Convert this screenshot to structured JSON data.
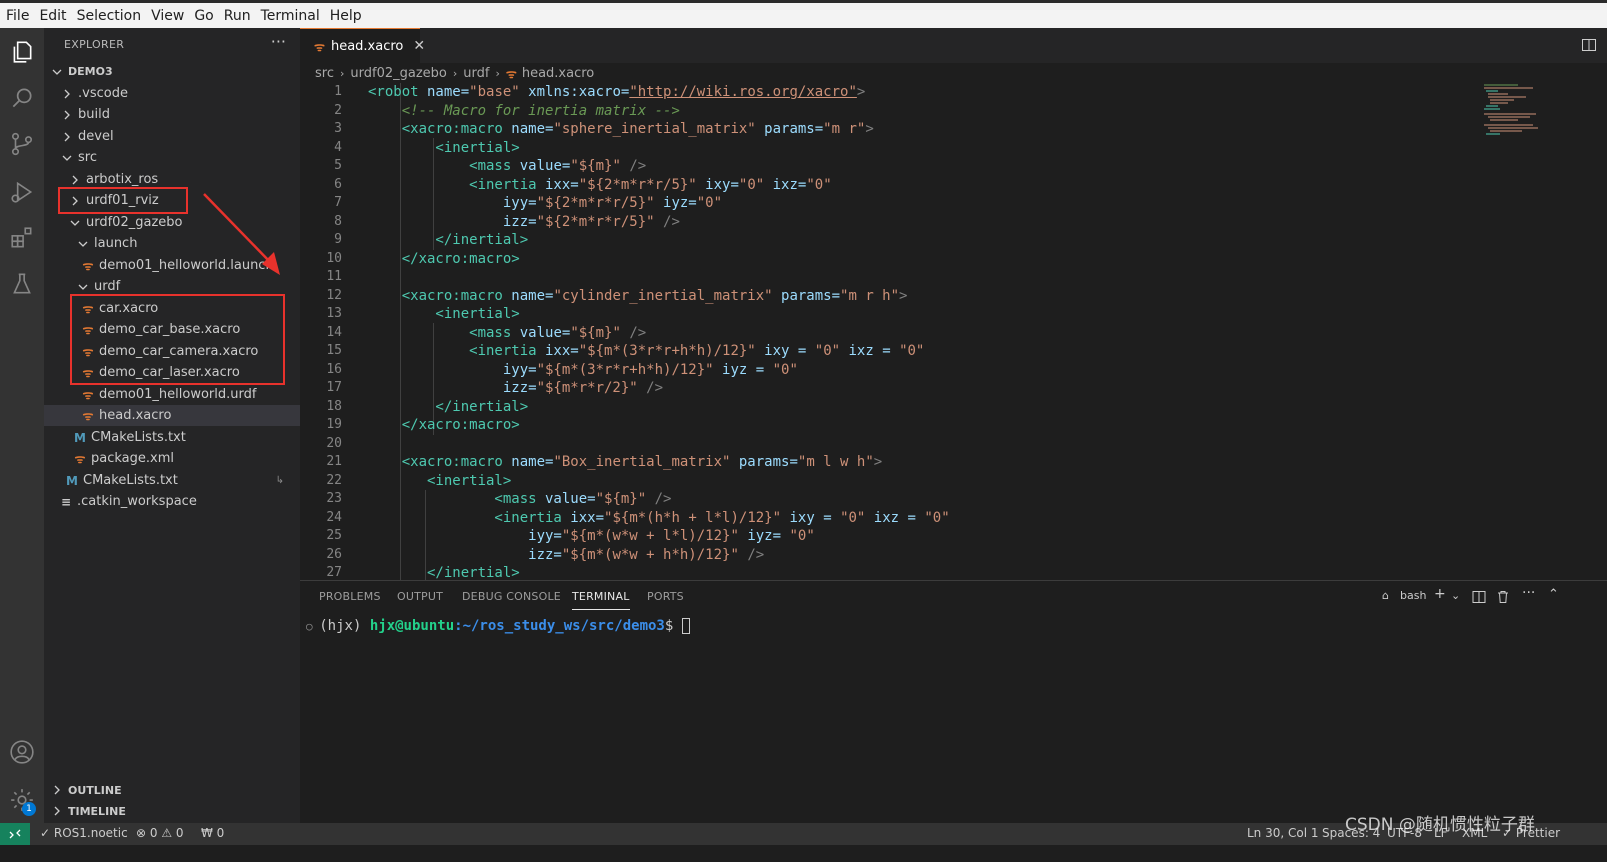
{
  "menu": [
    "File",
    "Edit",
    "Selection",
    "View",
    "Go",
    "Run",
    "Terminal",
    "Help"
  ],
  "activity_bar": {
    "icons": [
      "explorer-icon",
      "search-icon",
      "source-control-icon",
      "run-debug-icon",
      "extensions-icon",
      "testing-icon",
      "account-icon",
      "settings-gear-icon"
    ],
    "settings_badge": "1"
  },
  "sidebar": {
    "title": "EXPLORER",
    "more": "···",
    "root": "DEMO3",
    "tree": [
      {
        "label": ".vscode",
        "icon": "chevron-right-icon"
      },
      {
        "label": "build",
        "icon": "chevron-right-icon"
      },
      {
        "label": "devel",
        "icon": "chevron-right-icon"
      },
      {
        "label": "src",
        "icon": "chevron-down-icon"
      },
      {
        "label": "arbotix_ros",
        "icon": "chevron-right-icon"
      },
      {
        "label": "urdf01_rviz",
        "icon": "chevron-right-icon"
      },
      {
        "label": "urdf02_gazebo",
        "icon": "chevron-down-icon"
      },
      {
        "label": "launch",
        "icon": "chevron-down-icon"
      },
      {
        "label": "demo01_helloworld.launch",
        "icon": "rss-file-icon"
      },
      {
        "label": "urdf",
        "icon": "chevron-down-icon"
      },
      {
        "label": "car.xacro",
        "icon": "rss-file-icon"
      },
      {
        "label": "demo_car_base.xacro",
        "icon": "rss-file-icon"
      },
      {
        "label": "demo_car_camera.xacro",
        "icon": "rss-file-icon"
      },
      {
        "label": "demo_car_laser.xacro",
        "icon": "rss-file-icon"
      },
      {
        "label": "demo01_helloworld.urdf",
        "icon": "rss-file-icon"
      },
      {
        "label": "head.xacro",
        "icon": "rss-file-icon"
      },
      {
        "label": "CMakeLists.txt",
        "icon": "cmake-file-icon"
      },
      {
        "label": "package.xml",
        "icon": "rss-file-icon"
      },
      {
        "label": "CMakeLists.txt",
        "icon": "cmake-file-icon"
      },
      {
        "label": ".catkin_workspace",
        "icon": "text-file-icon"
      }
    ],
    "outline": "OUTLINE",
    "timeline": "TIMELINE"
  },
  "editor": {
    "tab_label": "head.xacro",
    "tab_close": "✕",
    "breadcrumb": [
      "src",
      "urdf02_gazebo",
      "urdf",
      "head.xacro"
    ],
    "line_numbers": [
      "1",
      "2",
      "3",
      "4",
      "5",
      "6",
      "7",
      "8",
      "9",
      "10",
      "11",
      "12",
      "13",
      "14",
      "15",
      "16",
      "17",
      "18",
      "19",
      "20",
      "21",
      "22",
      "23",
      "24",
      "25",
      "26",
      "27"
    ],
    "code": {
      "l1_tag": "<robot",
      "l1_attr1": " name=",
      "l1_val1": "\"base\"",
      "l1_attr2": " xmlns:xacro=",
      "l1_link": "\"http://wiki.ros.org/xacro\"",
      "l1_end": ">",
      "l2": "    <!-- Macro for inertia matrix -->",
      "l3_tag": "    <xacro:macro",
      "l3_attr1": " name=",
      "l3_val1": "\"sphere_inertial_matrix\"",
      "l3_attr2": " params=",
      "l3_val2": "\"m r\"",
      "l3_end": ">",
      "l4": "        <inertial>",
      "l5_tag": "            <mass",
      "l5_attr": " value=",
      "l5_val": "\"${m}\"",
      "l5_end": " />",
      "l6_tag": "            <inertia",
      "l6_a1": " ixx=",
      "l6_v1": "\"${2*m*r*r/5}\"",
      "l6_a2": " ixy=",
      "l6_v2": "\"0\"",
      "l6_a3": " ixz=",
      "l6_v3": "\"0\"",
      "l7_a1": "                iyy=",
      "l7_v1": "\"${2*m*r*r/5}\"",
      "l7_a2": " iyz=",
      "l7_v2": "\"0\"",
      "l8_a1": "                izz=",
      "l8_v1": "\"${2*m*r*r/5}\"",
      "l8_end": " />",
      "l9": "        </inertial>",
      "l10": "    </xacro:macro>",
      "l12_tag": "    <xacro:macro",
      "l12_attr1": " name=",
      "l12_val1": "\"cylinder_inertial_matrix\"",
      "l12_attr2": " params=",
      "l12_val2": "\"m r h\"",
      "l12_end": ">",
      "l13": "        <inertial>",
      "l14_tag": "            <mass",
      "l14_attr": " value=",
      "l14_val": "\"${m}\"",
      "l14_end": " />",
      "l15_tag": "            <inertia",
      "l15_a1": " ixx=",
      "l15_v1": "\"${m*(3*r*r+h*h)/12}\"",
      "l15_a2": " ixy = ",
      "l15_v2": "\"0\"",
      "l15_a3": " ixz = ",
      "l15_v3": "\"0\"",
      "l16_a1": "                iyy=",
      "l16_v1": "\"${m*(3*r*r+h*h)/12}\"",
      "l16_a2": " iyz = ",
      "l16_v2": "\"0\"",
      "l17_a1": "                izz=",
      "l17_v1": "\"${m*r*r/2}\"",
      "l17_end": " />",
      "l18": "        </inertial>",
      "l19": "    </xacro:macro>",
      "l21_tag": "    <xacro:macro",
      "l21_attr1": " name=",
      "l21_val1": "\"Box_inertial_matrix\"",
      "l21_attr2": " params=",
      "l21_val2": "\"m l w h\"",
      "l21_end": ">",
      "l22": "       <inertial>",
      "l23_tag": "               <mass",
      "l23_attr": " value=",
      "l23_val": "\"${m}\"",
      "l23_end": " />",
      "l24_tag": "               <inertia",
      "l24_a1": " ixx=",
      "l24_v1": "\"${m*(h*h + l*l)/12}\"",
      "l24_a2": " ixy = ",
      "l24_v2": "\"0\"",
      "l24_a3": " ixz = ",
      "l24_v3": "\"0\"",
      "l25_a1": "                   iyy=",
      "l25_v1": "\"${m*(w*w + l*l)/12}\"",
      "l25_a2": " iyz= ",
      "l25_v2": "\"0\"",
      "l26_a1": "                   izz=",
      "l26_v1": "\"${m*(w*w + h*h)/12}\"",
      "l26_end": " />",
      "l27": "       </inertial>"
    }
  },
  "panel": {
    "tabs": [
      "PROBLEMS",
      "OUTPUT",
      "DEBUG CONSOLE",
      "TERMINAL",
      "PORTS"
    ],
    "active_tab": "TERMINAL",
    "shell": "bash",
    "terminal": {
      "env": "(hjx)",
      "user_host": "hjx@ubuntu",
      "path": ":~/ros_study_ws/src/demo3",
      "prompt": "$ "
    }
  },
  "statusbar": {
    "remote_icon": "remote-icon",
    "ros": "✓ ROS1.noetic",
    "problems": "⊗ 0 ⚠ 0",
    "ports": "₩ 0",
    "position": "Ln 30, Col 1",
    "spaces": "Spaces: 4",
    "encoding": "UTF-8",
    "eol": "LF",
    "language": "XML",
    "prettier": "✓ Prettier"
  },
  "watermark": "CSDN @随机惯性粒子群",
  "colors": {
    "annotation_red": "#e8322c",
    "tag_green": "#4ec9b0",
    "attr_blue": "#9cdcfe",
    "string_orange": "#ce9178",
    "comment_green": "#6a9955",
    "rss_orange": "#e37933"
  }
}
